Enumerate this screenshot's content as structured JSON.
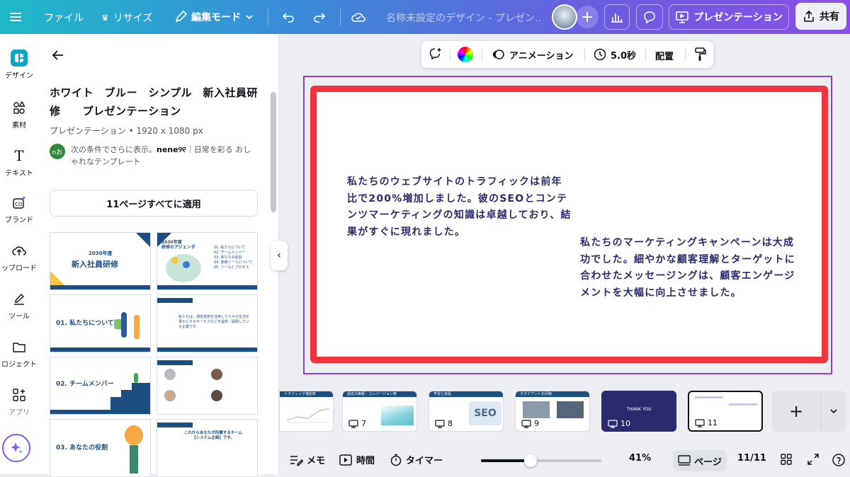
{
  "topbar": {
    "file": "ファイル",
    "resize": "リサイズ",
    "edit_mode": "編集モード",
    "doc_title": "名称未設定のデザイン - プレゼン...",
    "present": "プレゼンテーション",
    "share": "共有"
  },
  "rail": {
    "design": "デザイン",
    "elements": "素材",
    "text": "テキスト",
    "brand": "ブランド",
    "upload": "ップロード",
    "tools": "ツール",
    "projects": "ロジェクト",
    "apps": "アプリ"
  },
  "panel": {
    "title": "ホワイト　ブルー　シンプル　新入社員研修　　プレゼンテーション",
    "meta": "プレゼンテーション • 1920 x 1080 px",
    "author_prefix": "次の条件でさらに表示。",
    "author_name": "nene୨୧",
    "author_suffix": "｜日常を彩る おしゃれなテンプレート",
    "author_initials": "nお",
    "apply_all": "11ページすべてに適用",
    "thumbs": {
      "t1_title": "2030年度",
      "t1_big": "新入社員研修",
      "t2_title": "2030年度\n研修のアジェンダ",
      "t2_items": "01. 私たちについて\n02. チームメンバー\n03. あなたの役割\n04. 使用ツールについて\n05. ツールとプロセス",
      "t3_title": "01. 私たちについて",
      "t4_text": "私たちは、通信技術を活用して人々の生活を豊かにするサービスなどを提供・開発している企業です。",
      "t5_title": "02. チームメンバー",
      "t7_title": "03. あなたの役割",
      "t8_title": "これからあなたが所属するチーム\n【システム企画】です。"
    }
  },
  "context_bar": {
    "animation": "アニメーション",
    "duration": "5.0秒",
    "arrange": "配置"
  },
  "slide": {
    "text_left": "私たちのウェブサイトのトラフィックは前年比で200%増加しました。彼のSEOとコンテンツマーケティングの知識は卓越しており、結果がすぐに現れました。",
    "text_right": "私たちのマーケティングキャンペーンは大成功でした。細やかな顧客理解とターゲットに合わせたメッセージングは、顧客エンゲージメントを大幅に向上させました。",
    "border_color": "#ef3340",
    "text_color": "#2a2a6e"
  },
  "filmstrip": {
    "pages": [
      {
        "num": "",
        "header": "トラフィック増加率"
      },
      {
        "num": "7",
        "header": "過去の実績・コンバージョン率"
      },
      {
        "num": "8",
        "header": "学習と成長"
      },
      {
        "num": "9",
        "header": "クライアントの評価"
      },
      {
        "num": "10",
        "header": "THANK YOU"
      },
      {
        "num": "11",
        "header": ""
      }
    ]
  },
  "bottombar": {
    "notes": "メモ",
    "time": "時間",
    "timer": "タイマー",
    "zoom": "41%",
    "zoom_fraction": 0.41,
    "pages": "ページ",
    "page_count": "11/11"
  }
}
